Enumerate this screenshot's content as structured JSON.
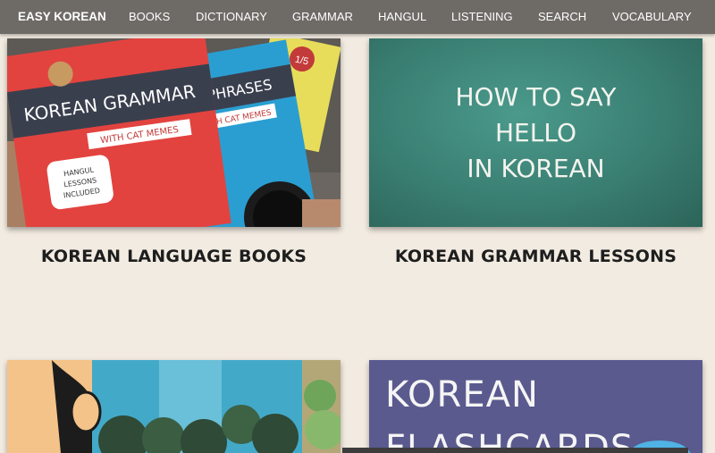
{
  "nav": {
    "brand": "EASY KOREAN",
    "items": [
      "BOOKS",
      "DICTIONARY",
      "GRAMMAR",
      "HANGUL",
      "LISTENING",
      "SEARCH",
      "VOCABULARY"
    ]
  },
  "cards": [
    {
      "title": "KOREAN LANGUAGE BOOKS",
      "book1_title": "KOREAN GRAMMAR",
      "book1_sub": "WITH CAT MEMES",
      "book1_badge_l1": "HANGUL",
      "book1_badge_l2": "LESSONS",
      "book1_badge_l3": "INCLUDED",
      "book2_title": "EAN PHRASES",
      "book2_sub": "WITH CAT MEMES",
      "book3_tag": "1/5"
    },
    {
      "title": "KOREAN GRAMMAR LESSONS",
      "lines": [
        "HOW TO SAY",
        "HELLO",
        "IN KOREAN"
      ]
    },
    {
      "title": ""
    },
    {
      "title": "",
      "line1": "KOREAN",
      "line2": "FLASHCARDS"
    }
  ],
  "colors": {
    "nav_bg": "#6e6a66",
    "page_bg": "#f2ebe1",
    "chalk_green": "#3d8a7c",
    "flashcard_purple": "#5a5a8f"
  }
}
